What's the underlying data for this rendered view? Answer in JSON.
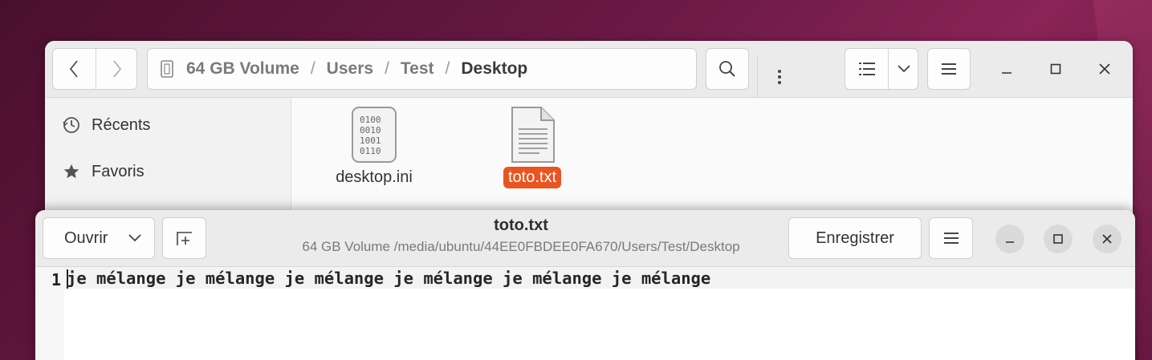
{
  "files_window": {
    "path": [
      "64 GB Volume",
      "Users",
      "Test",
      "Desktop"
    ],
    "separator": "/",
    "sidebar": [
      {
        "label": "Récents",
        "icon": "clock-icon"
      },
      {
        "label": "Favoris",
        "icon": "star-icon"
      }
    ],
    "files": [
      {
        "name": "desktop.ini",
        "icon": "binary-file-icon",
        "selected": false
      },
      {
        "name": "toto.txt",
        "icon": "text-file-icon",
        "selected": true
      }
    ]
  },
  "editor_window": {
    "title": "toto.txt",
    "subtitle": "64 GB Volume /media/ubuntu/44EE0FBDEE0FA670/Users/Test/Desktop",
    "open_label": "Ouvrir",
    "save_label": "Enregistrer",
    "lines": [
      {
        "number": "1",
        "text": "je mélange je mélange je mélange je mélange je mélange je mélange"
      }
    ]
  },
  "colors": {
    "accent": "#e95420"
  }
}
